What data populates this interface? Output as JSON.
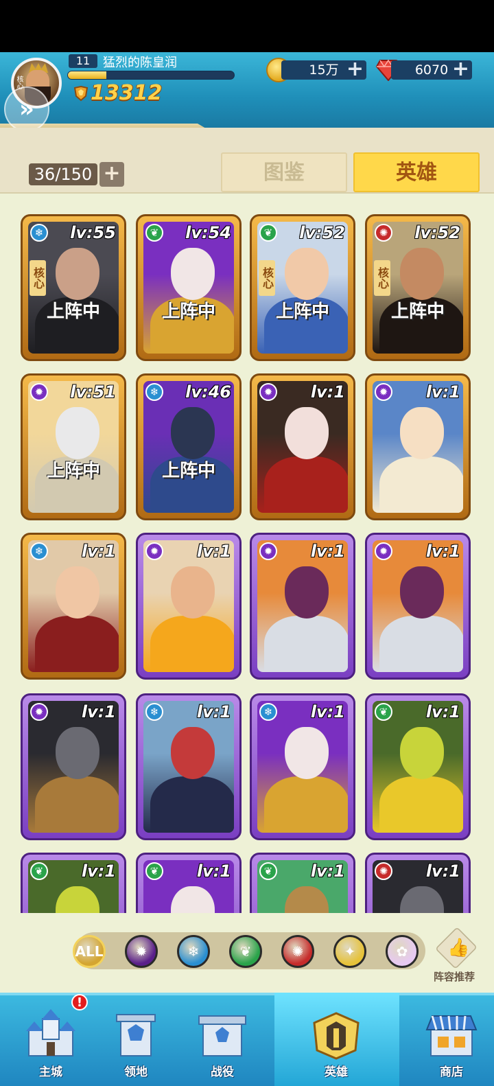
{
  "player": {
    "level": "11",
    "name": "猛烈的陈皇润",
    "xp_progress": 0.23,
    "power": "13312",
    "avatar_tag": "核心"
  },
  "resources": {
    "gold": "15万",
    "gems": "6070"
  },
  "roster": {
    "count": "36/150"
  },
  "tabs": {
    "codex": "图鉴",
    "heroes": "英雄"
  },
  "heroes": [
    {
      "lv": "lv:55",
      "element": "ice",
      "frame": "gold",
      "core": "核心",
      "deployed": "上阵中",
      "art": "witch-dark"
    },
    {
      "lv": "lv:54",
      "element": "nature",
      "frame": "gold",
      "core": "",
      "deployed": "上阵中",
      "art": "dwarf-gold"
    },
    {
      "lv": "lv:52",
      "element": "nature",
      "frame": "gold",
      "core": "核心",
      "deployed": "上阵中",
      "art": "blonde-lady"
    },
    {
      "lv": "lv:52",
      "element": "fire",
      "frame": "gold",
      "core": "核心",
      "deployed": "上阵中",
      "art": "bearded-general"
    },
    {
      "lv": "lv:51",
      "element": "arcane",
      "frame": "gold",
      "core": "",
      "deployed": "上阵中",
      "art": "white-knight"
    },
    {
      "lv": "lv:46",
      "element": "ice",
      "frame": "gold",
      "core": "",
      "deployed": "上阵中",
      "art": "hooded-mage"
    },
    {
      "lv": "lv:1",
      "element": "arcane",
      "frame": "gold",
      "core": "",
      "deployed": "",
      "art": "red-queen"
    },
    {
      "lv": "lv:1",
      "element": "arcane",
      "frame": "gold",
      "core": "",
      "deployed": "",
      "art": "golden-goddess"
    },
    {
      "lv": "lv:1",
      "element": "ice",
      "frame": "gold",
      "core": "",
      "deployed": "",
      "art": "red-witch"
    },
    {
      "lv": "lv:1",
      "element": "arcane",
      "frame": "purple",
      "core": "",
      "deployed": "",
      "art": "old-paladin"
    },
    {
      "lv": "lv:1",
      "element": "arcane",
      "frame": "purple",
      "core": "",
      "deployed": "",
      "art": "purple-beard"
    },
    {
      "lv": "lv:1",
      "element": "arcane",
      "frame": "purple",
      "core": "",
      "deployed": "",
      "art": "purple-beard"
    },
    {
      "lv": "lv:1",
      "element": "arcane",
      "frame": "purple",
      "core": "",
      "deployed": "",
      "art": "dark-knight"
    },
    {
      "lv": "lv:1",
      "element": "ice",
      "frame": "purple",
      "core": "",
      "deployed": "",
      "art": "fox-mask"
    },
    {
      "lv": "lv:1",
      "element": "ice",
      "frame": "purple",
      "core": "",
      "deployed": "",
      "art": "dwarf-gold"
    },
    {
      "lv": "lv:1",
      "element": "nature",
      "frame": "purple",
      "core": "",
      "deployed": "",
      "art": "treant"
    },
    {
      "lv": "lv:1",
      "element": "nature",
      "frame": "purple",
      "core": "",
      "deployed": "",
      "art": "treant"
    },
    {
      "lv": "lv:1",
      "element": "nature",
      "frame": "purple",
      "core": "",
      "deployed": "",
      "art": "dwarf-gold"
    },
    {
      "lv": "lv:1",
      "element": "nature",
      "frame": "purple",
      "core": "",
      "deployed": "",
      "art": "helmet-warrior"
    },
    {
      "lv": "lv:1",
      "element": "fire",
      "frame": "purple",
      "core": "",
      "deployed": "",
      "art": "dark-knight"
    }
  ],
  "filters": [
    {
      "name": "filter-all",
      "label": "ALL",
      "color": "#d4a531"
    },
    {
      "name": "filter-arcane",
      "label": "",
      "color": "#5a1f8a"
    },
    {
      "name": "filter-ice",
      "label": "",
      "color": "#2a8fd1"
    },
    {
      "name": "filter-nature",
      "label": "",
      "color": "#2aa34a"
    },
    {
      "name": "filter-fire",
      "label": "",
      "color": "#c62b2b"
    },
    {
      "name": "filter-holy",
      "label": "",
      "color": "#e6c23a"
    },
    {
      "name": "filter-spirit",
      "label": "",
      "color": "#e7c9f2"
    }
  ],
  "lineup": {
    "label": "阵容推荐"
  },
  "nav": {
    "main_city": "主城",
    "territory": "领地",
    "campaign": "战役",
    "heroes": "英雄",
    "shop": "商店",
    "badge": "!"
  },
  "colors": {
    "header": "#2aa6cf",
    "content_bg": "#eef1d6",
    "tab_active": "#ffd84a",
    "power": "#ffd24a"
  }
}
